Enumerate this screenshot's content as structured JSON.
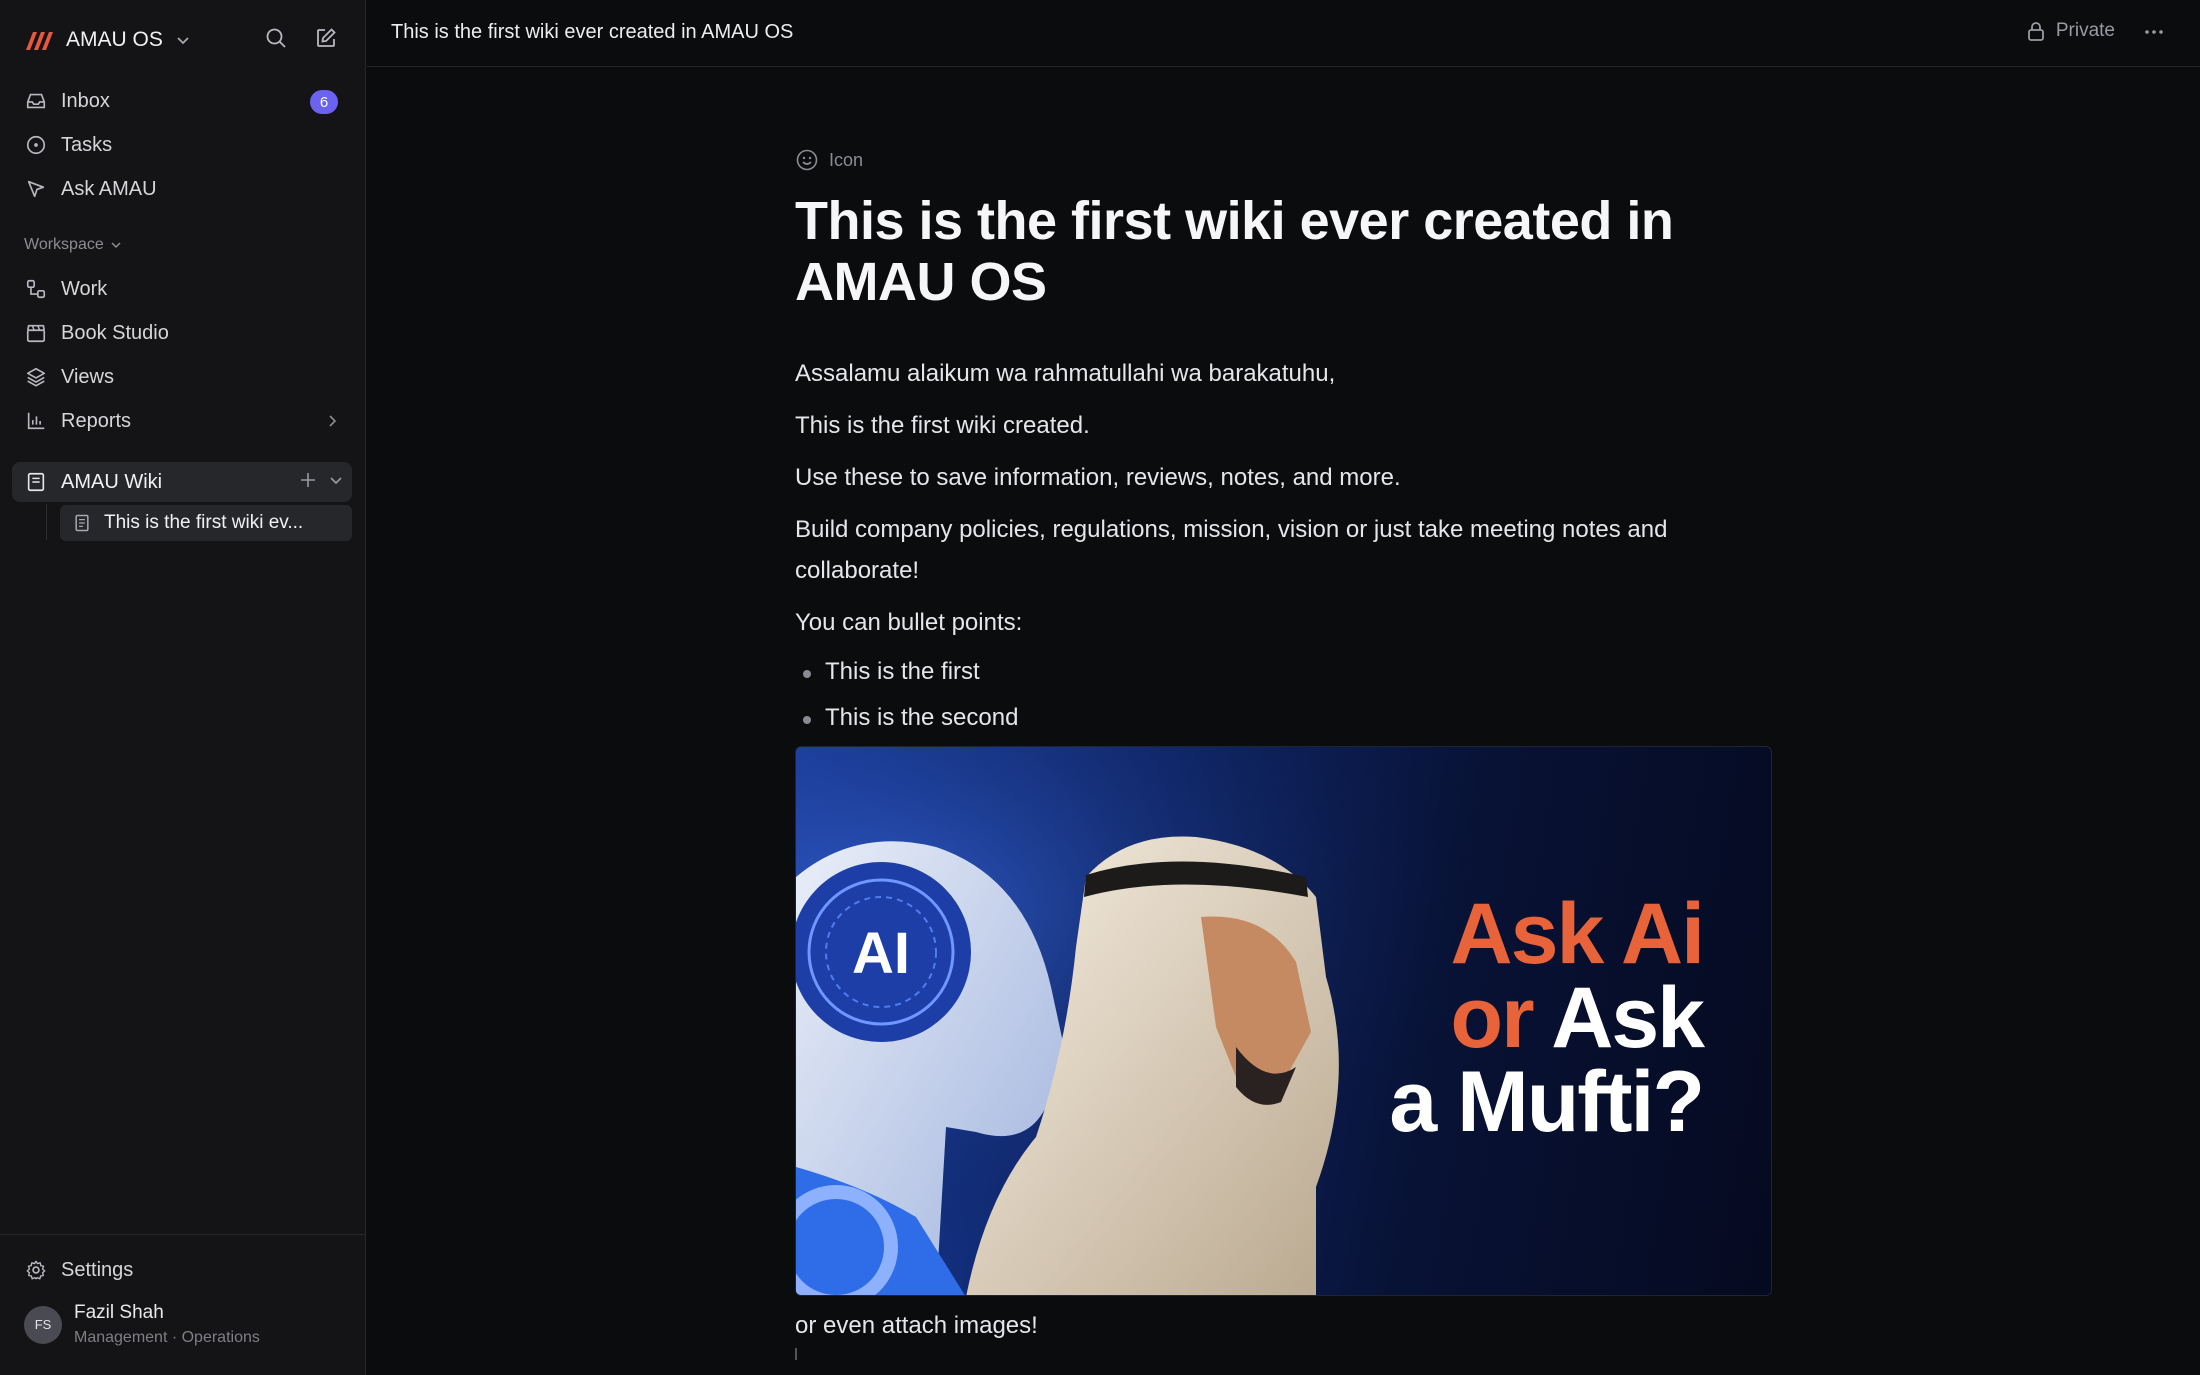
{
  "workspace": {
    "name": "AMAU OS"
  },
  "nav": {
    "inbox": "Inbox",
    "inbox_count": "6",
    "tasks": "Tasks",
    "ask": "Ask AMAU"
  },
  "workspace_section": {
    "label": "Workspace",
    "items": [
      "Work",
      "Book Studio",
      "Views",
      "Reports"
    ]
  },
  "wiki": {
    "label": "AMAU Wiki",
    "child": "This is the first wiki ev..."
  },
  "settings": "Settings",
  "user": {
    "initials": "FS",
    "name": "Fazil Shah",
    "role": "Management · Operations"
  },
  "topbar": {
    "title": "This is the first wiki ever created in AMAU OS",
    "privacy": "Private"
  },
  "doc": {
    "icon_label": "Icon",
    "title": "This is the first wiki ever created in AMAU OS",
    "paragraphs": [
      "Assalamu alaikum wa rahmatullahi wa barakatuhu,",
      "This is the first wiki created.",
      "Use these to save information, reviews, notes, and more.",
      "Build company policies, regulations, mission, vision or just take meeting notes and collaborate!",
      "You can bullet points:"
    ],
    "bullets": [
      "This is the first",
      "This is the second"
    ],
    "image_text": {
      "robot_label": "AI",
      "line1": "Ask Ai",
      "line2_a": "or",
      "line2_b": "Ask",
      "line3": "a Mufti?"
    },
    "caption": "or even attach images!"
  },
  "colors": {
    "accent": "#6b63f0",
    "hero_orange": "#e9633a",
    "background": "#0b0c0e",
    "sidebar": "#141416"
  }
}
